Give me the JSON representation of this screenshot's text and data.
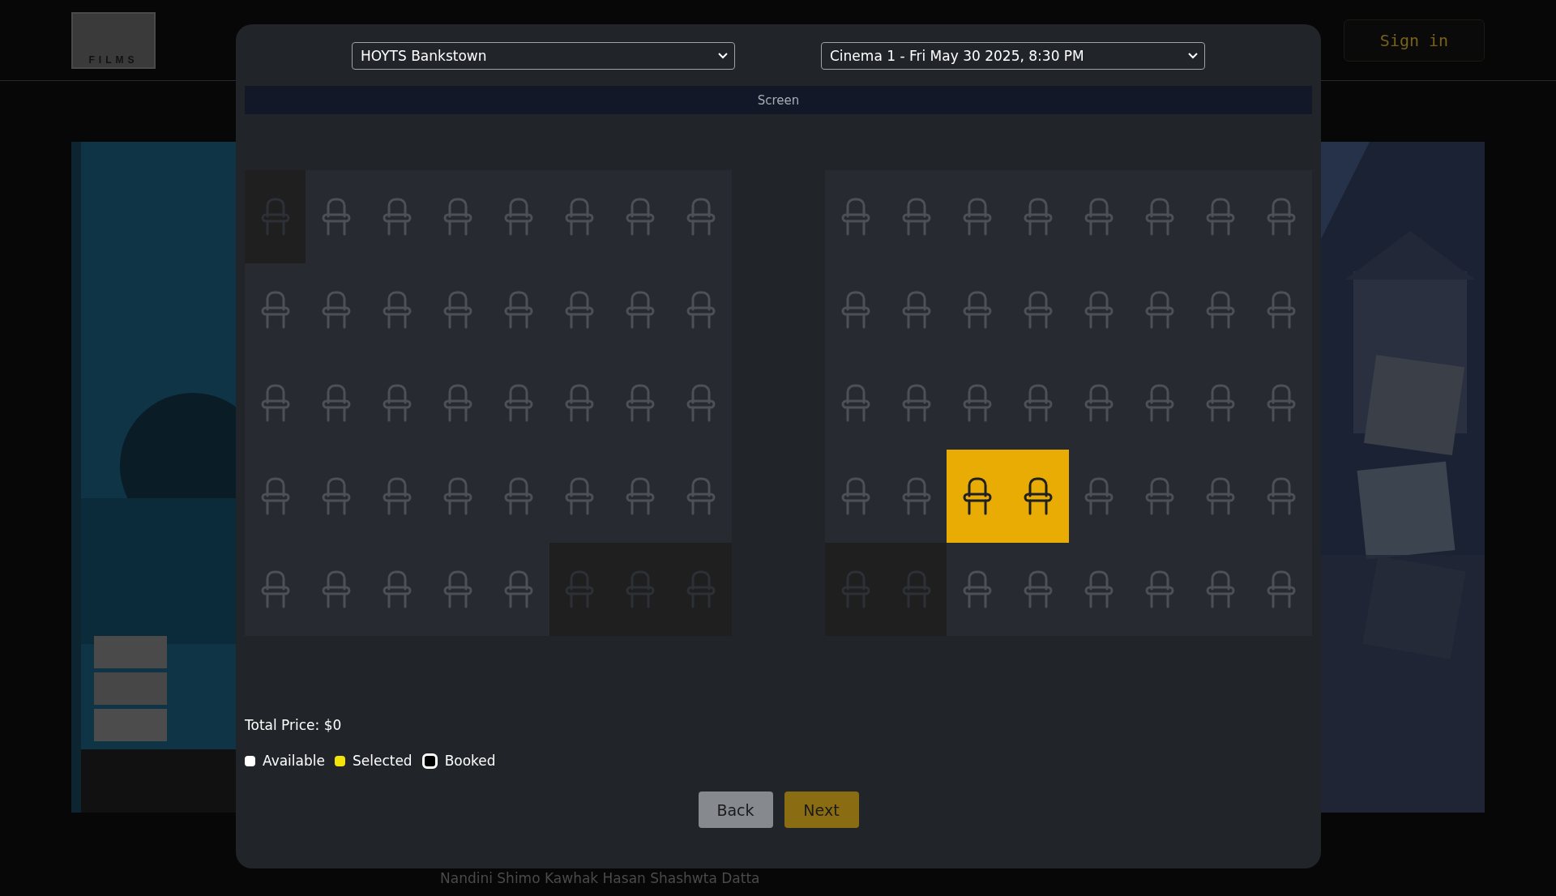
{
  "header": {
    "logo_text": "FILMS",
    "sign_in": "Sign in"
  },
  "footer_text": "Nandini Shimo Kawhak Hasan Shashwta Datta",
  "modal": {
    "cinema_select": {
      "value": "HOYTS Bankstown"
    },
    "session_select": {
      "value": "Cinema 1 - Fri May 30 2025, 8:30 PM"
    },
    "screen_label": "Screen",
    "seat_blocks": [
      {
        "rows": [
          [
            {
              "booked": true,
              "selected": false
            },
            {
              "booked": false,
              "selected": false
            },
            {
              "booked": false,
              "selected": false
            },
            {
              "booked": false,
              "selected": false
            },
            {
              "booked": false,
              "selected": false
            },
            {
              "booked": false,
              "selected": false
            },
            {
              "booked": false,
              "selected": false
            },
            {
              "booked": false,
              "selected": false
            }
          ],
          [
            {
              "booked": false,
              "selected": false
            },
            {
              "booked": false,
              "selected": false
            },
            {
              "booked": false,
              "selected": false
            },
            {
              "booked": false,
              "selected": false
            },
            {
              "booked": false,
              "selected": false
            },
            {
              "booked": false,
              "selected": false
            },
            {
              "booked": false,
              "selected": false
            },
            {
              "booked": false,
              "selected": false
            }
          ],
          [
            {
              "booked": false,
              "selected": false
            },
            {
              "booked": false,
              "selected": false
            },
            {
              "booked": false,
              "selected": false
            },
            {
              "booked": false,
              "selected": false
            },
            {
              "booked": false,
              "selected": false
            },
            {
              "booked": false,
              "selected": false
            },
            {
              "booked": false,
              "selected": false
            },
            {
              "booked": false,
              "selected": false
            }
          ],
          [
            {
              "booked": false,
              "selected": false
            },
            {
              "booked": false,
              "selected": false
            },
            {
              "booked": false,
              "selected": false
            },
            {
              "booked": false,
              "selected": false
            },
            {
              "booked": false,
              "selected": false
            },
            {
              "booked": false,
              "selected": false
            },
            {
              "booked": false,
              "selected": false
            },
            {
              "booked": false,
              "selected": false
            }
          ],
          [
            {
              "booked": false,
              "selected": false
            },
            {
              "booked": false,
              "selected": false
            },
            {
              "booked": false,
              "selected": false
            },
            {
              "booked": false,
              "selected": false
            },
            {
              "booked": false,
              "selected": false
            },
            {
              "booked": true,
              "selected": false
            },
            {
              "booked": true,
              "selected": false
            },
            {
              "booked": true,
              "selected": false
            }
          ]
        ]
      },
      {
        "rows": [
          [
            {
              "booked": false,
              "selected": false
            },
            {
              "booked": false,
              "selected": false
            },
            {
              "booked": false,
              "selected": false
            },
            {
              "booked": false,
              "selected": false
            },
            {
              "booked": false,
              "selected": false
            },
            {
              "booked": false,
              "selected": false
            },
            {
              "booked": false,
              "selected": false
            },
            {
              "booked": false,
              "selected": false
            }
          ],
          [
            {
              "booked": false,
              "selected": false
            },
            {
              "booked": false,
              "selected": false
            },
            {
              "booked": false,
              "selected": false
            },
            {
              "booked": false,
              "selected": false
            },
            {
              "booked": false,
              "selected": false
            },
            {
              "booked": false,
              "selected": false
            },
            {
              "booked": false,
              "selected": false
            },
            {
              "booked": false,
              "selected": false
            }
          ],
          [
            {
              "booked": false,
              "selected": false
            },
            {
              "booked": false,
              "selected": false
            },
            {
              "booked": false,
              "selected": false
            },
            {
              "booked": false,
              "selected": false
            },
            {
              "booked": false,
              "selected": false
            },
            {
              "booked": false,
              "selected": false
            },
            {
              "booked": false,
              "selected": false
            },
            {
              "booked": false,
              "selected": false
            }
          ],
          [
            {
              "booked": false,
              "selected": false
            },
            {
              "booked": false,
              "selected": false
            },
            {
              "booked": false,
              "selected": true
            },
            {
              "booked": false,
              "selected": true
            },
            {
              "booked": false,
              "selected": false
            },
            {
              "booked": false,
              "selected": false
            },
            {
              "booked": false,
              "selected": false
            },
            {
              "booked": false,
              "selected": false
            }
          ],
          [
            {
              "booked": true,
              "selected": false
            },
            {
              "booked": true,
              "selected": false
            },
            {
              "booked": false,
              "selected": false
            },
            {
              "booked": false,
              "selected": false
            },
            {
              "booked": false,
              "selected": false
            },
            {
              "booked": false,
              "selected": false
            },
            {
              "booked": false,
              "selected": false
            },
            {
              "booked": false,
              "selected": false
            }
          ]
        ]
      }
    ],
    "total_price": "Total Price: $0",
    "legend": [
      {
        "kind": "available",
        "label": "Available"
      },
      {
        "kind": "selected",
        "label": "Selected"
      },
      {
        "kind": "booked",
        "label": "Booked"
      }
    ],
    "buttons": [
      {
        "kind": "back",
        "label": "Back"
      },
      {
        "kind": "next",
        "label": "Next"
      }
    ]
  }
}
